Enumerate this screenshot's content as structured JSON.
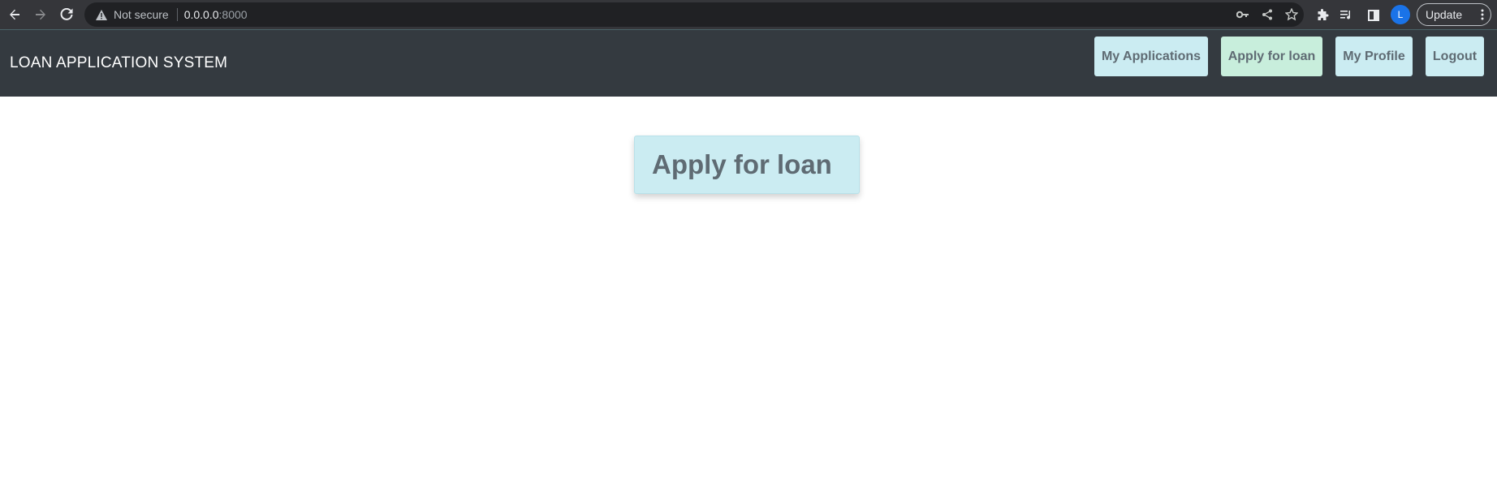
{
  "browser": {
    "security_label": "Not secure",
    "url_host": "0.0.0.0",
    "url_port": ":8000",
    "avatar_initial": "L",
    "update_label": "Update"
  },
  "navbar": {
    "brand": "LOAN APPLICATION SYSTEM",
    "items": [
      {
        "label": "My Applications"
      },
      {
        "label": "Apply for loan",
        "active": true
      },
      {
        "label": "My Profile"
      },
      {
        "label": "Logout"
      }
    ]
  },
  "main": {
    "title": "Apply for loan"
  },
  "colors": {
    "navbar_bg": "#343a40",
    "button_bg": "#cbecf2",
    "active_button_bg": "#c8eedc",
    "button_text": "#5f6b73"
  }
}
